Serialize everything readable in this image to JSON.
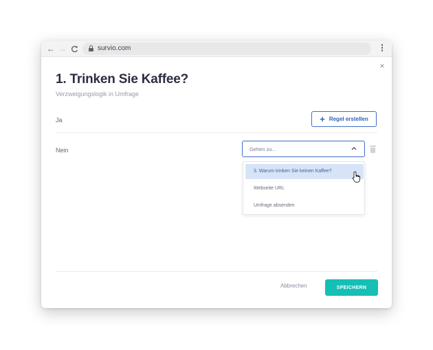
{
  "browser": {
    "url": "survio.com",
    "back_icon": "←",
    "forward_icon": "→",
    "reload_icon": "C"
  },
  "dialog": {
    "close_icon": "×",
    "title": "1. Trinken Sie Kaffee?",
    "subtitle": "Verzweigungslogik in Umfrage"
  },
  "answers": [
    {
      "label": "Ja",
      "action_label": "Regel erstellen"
    },
    {
      "label": "Nein",
      "select_value": "Gehen zu..."
    }
  ],
  "dropdown": {
    "options": [
      "3. Warum trinken Sie keinen Kaffee?",
      "Webseite URL",
      "Umfrage absenden"
    ],
    "highlighted_index": 0
  },
  "footer": {
    "cancel_label": "Abbrechen",
    "save_label": "SPEICHERN"
  },
  "colors": {
    "accent_blue": "#3b6fc9",
    "save_teal": "#16bfb5",
    "highlight": "#d7e4f8"
  }
}
